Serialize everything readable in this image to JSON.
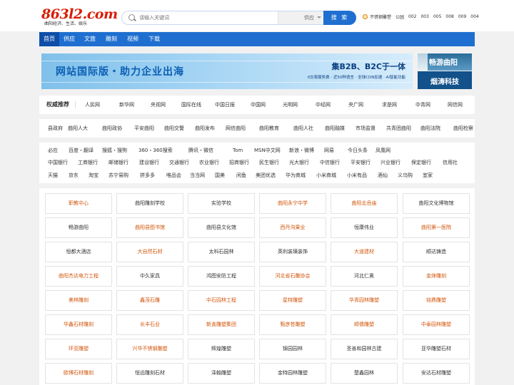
{
  "header": {
    "logo_text": "863l2.com",
    "logo_tagline": "曲阳经济、生活、娱乐",
    "search": {
      "placeholder": "请输入关键词",
      "category": "供应",
      "button": "搜 索"
    },
    "quick_links": [
      "不锈钢雕塑",
      "公园",
      "002",
      "003",
      "005",
      "008",
      "009",
      "004"
    ]
  },
  "nav": {
    "items": [
      "首页",
      "供应",
      "文旅",
      "雕刻",
      "视频",
      "下载"
    ],
    "active": "首页"
  },
  "banner": {
    "title": "网站国际版・助力企业出海",
    "subtitle": "集B2B、B2C于一体",
    "detail": "0交易服务费 · 近50种语言 · 全球CDN加速 · AI智能功能"
  },
  "side_ad": {
    "top": "畅游曲阳",
    "bottom": "烟涛科技"
  },
  "authority": {
    "title": "权威推荐",
    "links": [
      "人民网",
      "新华网",
      "央视网",
      "国际在线",
      "中国日报",
      "中国网",
      "光明网",
      "中经网",
      "央广网",
      "求是网",
      "中青网",
      "网信网"
    ]
  },
  "county_links": [
    "县政府",
    "曲阳人大",
    "曲阳政协",
    "平安曲阳",
    "曲阳交警",
    "曲阳发布",
    "网信曲阳",
    "曲阳教育",
    "曲阳人社",
    "曲阳融媒",
    "市场监督",
    "共青团曲阳",
    "曲阳法院",
    "曲阳检察"
  ],
  "site_links": [
    [
      "必应",
      "百度・翻译",
      "搜狐・搜狗",
      "360・360搜索",
      "腾讯・微信",
      "Tom",
      "MSN中文网",
      "新浪・微博",
      "网易",
      "今日头条",
      "凤凰网"
    ],
    [
      "中国银行",
      "工商银行",
      "邮储银行",
      "建设银行",
      "交通银行",
      "农业银行",
      "招商银行",
      "民生银行",
      "光大银行",
      "中信银行",
      "平安银行",
      "兴业银行",
      "保定银行",
      "信用社"
    ],
    [
      "天猫",
      "京东",
      "淘宝",
      "苏宁易购",
      "拼多多",
      "唯品会",
      "当当网",
      "国美",
      "闲鱼",
      "美团优选",
      "华为商城",
      "小米商城",
      "小米有品",
      "酒仙",
      "义乌购",
      "宜家"
    ]
  ],
  "grid": [
    [
      "职教中心",
      "曲阳雕刻学校",
      "实验学校",
      "曲阳永宁中学",
      "曲阳北岳庙",
      "曲阳文化博物馆"
    ],
    [
      "畅游曲阳",
      "曲阳县图书馆",
      "曲阳县文化馆",
      "西丹沟果业",
      "恒康伟业",
      "曲阳第一医院"
    ],
    [
      "恒都大酒店",
      "大自然石材",
      "太科石园林",
      "英利装璜装饰",
      "大道建材",
      "顺达铸造"
    ],
    [
      "曲阳杰达电力工程",
      "中久家具",
      "鸿图安防工程",
      "河北省石雕协会",
      "河北仁奥",
      "金烽雕刻"
    ],
    [
      "美林雕刻",
      "鑫茂石雕",
      "中石园林工程",
      "星特雕塑",
      "华青园林雕塑",
      "铭鼎雕塑"
    ],
    [
      "华鑫石材雕刻",
      "长丰石业",
      "新盖雕塑集团",
      "甄彦苍雕塑",
      "顺儒雕塑",
      "中泰园林雕塑"
    ],
    [
      "环亚雕塑",
      "兴华不锈钢雕塑",
      "辉煌雕塑",
      "锦园园林",
      "圣善和园林古建",
      "亚华雕塑石材"
    ],
    [
      "欧博石材雕刻",
      "恒远雕刻石材",
      "泽翰雕塑",
      "金特园林雕塑",
      "楚鑫园林",
      "安达石材雕塑"
    ]
  ],
  "grid_highlighted": [
    "职教中心",
    "曲阳永宁中学",
    "曲阳北岳庙",
    "曲阳县图书馆",
    "西丹沟果业",
    "曲阳第一医院",
    "大自然石材",
    "大道建材",
    "曲阳杰达电力工程",
    "河北省石雕协会",
    "金烽雕刻",
    "美林雕刻",
    "鑫茂石雕",
    "中石园林工程",
    "星特雕塑",
    "华青园林雕塑",
    "铭鼎雕塑",
    "华鑫石材雕刻",
    "长丰石业",
    "新盖雕塑集团",
    "甄彦苍雕塑",
    "顺儒雕塑",
    "中泰园林雕塑",
    "环亚雕塑",
    "兴华不锈钢雕塑",
    "欧博石材雕刻"
  ],
  "colors": {
    "brand_blue": "#1f6fd0",
    "logo_red": "#d81e06",
    "highlight_orange": "#d2550a"
  }
}
